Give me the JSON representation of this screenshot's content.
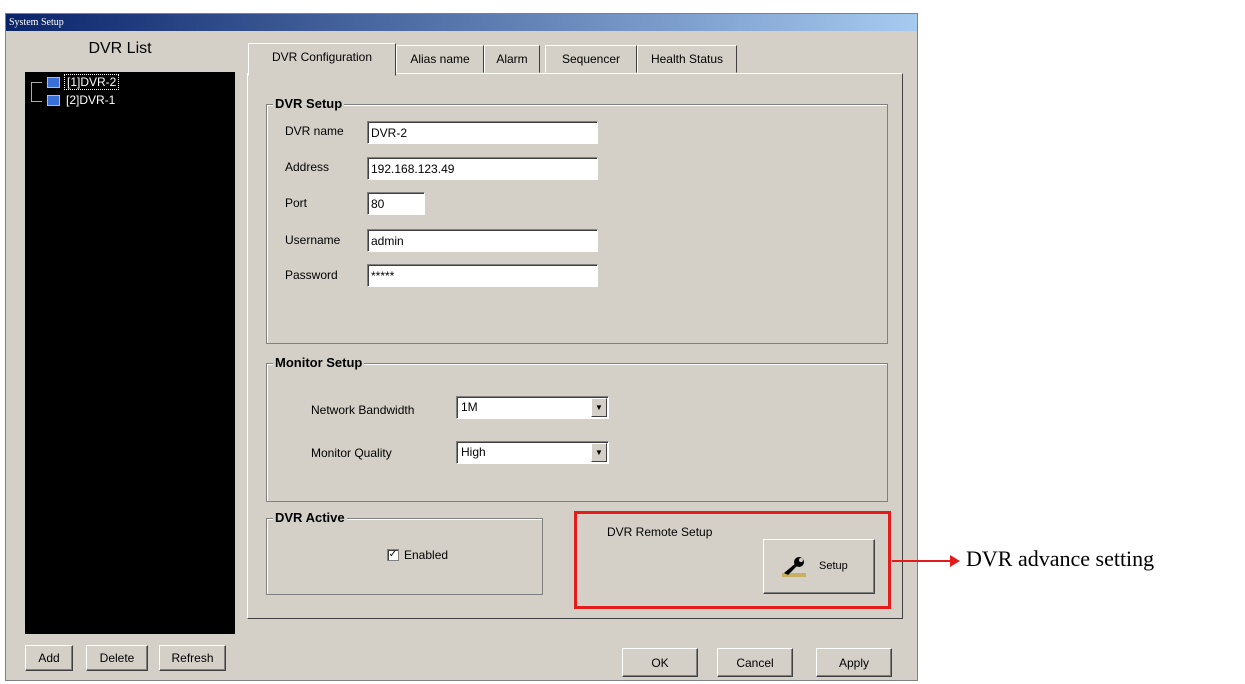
{
  "window": {
    "title": "System Setup"
  },
  "left": {
    "title": "DVR List",
    "items": [
      {
        "label": "[1]DVR-2",
        "selected": true
      },
      {
        "label": "[2]DVR-1",
        "selected": false
      }
    ],
    "buttons": {
      "add": "Add",
      "delete": "Delete",
      "refresh": "Refresh"
    }
  },
  "tabs": [
    "DVR Configuration",
    "Alias name",
    "Alarm",
    "Sequencer",
    "Health Status"
  ],
  "dvr_setup": {
    "title": "DVR Setup",
    "fields": {
      "name": {
        "label": "DVR name",
        "value": "DVR-2"
      },
      "address": {
        "label": "Address",
        "value": "192.168.123.49"
      },
      "port": {
        "label": "Port",
        "value": "80"
      },
      "username": {
        "label": "Username",
        "value": "admin"
      },
      "password": {
        "label": "Password",
        "value": "*****"
      }
    }
  },
  "monitor_setup": {
    "title": "Monitor Setup",
    "bandwidth": {
      "label": "Network Bandwidth",
      "value": "1M"
    },
    "quality": {
      "label": "Monitor Quality",
      "value": "High"
    }
  },
  "dvr_active": {
    "title": "DVR Active",
    "enabled_label": "Enabled",
    "enabled": true
  },
  "remote_setup": {
    "title": "DVR Remote Setup",
    "button": "Setup"
  },
  "footer": {
    "ok": "OK",
    "cancel": "Cancel",
    "apply": "Apply"
  },
  "annotation": {
    "text": "DVR advance setting",
    "color": "#e31b1b"
  },
  "colors": {
    "window_bg": "#d4d0c8",
    "tree_bg": "#000000",
    "title_bar": "#0a246a"
  }
}
